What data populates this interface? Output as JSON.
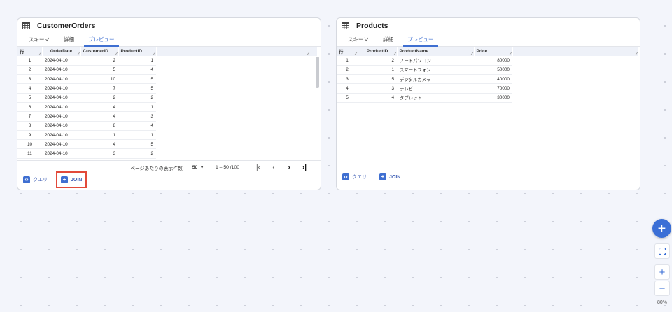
{
  "tabs": [
    "スキーマ",
    "詳細",
    "プレビュー"
  ],
  "orders": {
    "title": "CustomerOrders",
    "columns": [
      "行",
      "OrderDate",
      "CustomerID",
      "ProductID"
    ],
    "rows": [
      [
        "1",
        "2024-04-10",
        "2",
        "1"
      ],
      [
        "2",
        "2024-04-10",
        "5",
        "4"
      ],
      [
        "3",
        "2024-04-10",
        "10",
        "5"
      ],
      [
        "4",
        "2024-04-10",
        "7",
        "5"
      ],
      [
        "5",
        "2024-04-10",
        "2",
        "2"
      ],
      [
        "6",
        "2024-04-10",
        "4",
        "1"
      ],
      [
        "7",
        "2024-04-10",
        "4",
        "3"
      ],
      [
        "8",
        "2024-04-10",
        "8",
        "4"
      ],
      [
        "9",
        "2024-04-10",
        "1",
        "1"
      ],
      [
        "10",
        "2024-04-10",
        "4",
        "5"
      ],
      [
        "11",
        "2024-04-10",
        "3",
        "2"
      ]
    ],
    "pager": {
      "rows_per_page_label": "ページあたりの表示件数:",
      "rows_per_page": "50",
      "range": "1 – 50 /100"
    }
  },
  "products": {
    "title": "Products",
    "columns": [
      "行",
      "ProductID",
      "ProductName",
      "Price"
    ],
    "rows": [
      [
        "1",
        "2",
        "ノートパソコン",
        "80000"
      ],
      [
        "2",
        "1",
        "スマートフォン",
        "50000"
      ],
      [
        "3",
        "5",
        "デジタルカメラ",
        "40000"
      ],
      [
        "4",
        "3",
        "テレビ",
        "70000"
      ],
      [
        "5",
        "4",
        "タブレット",
        "30000"
      ]
    ]
  },
  "actions": {
    "query_label": "クエリ",
    "join_label": "JOIN"
  },
  "zoom": {
    "level": "80%"
  },
  "colors": {
    "accent": "#3f6fd1",
    "highlight": "#e24a3a"
  },
  "icons": {
    "table": "table-icon",
    "query": "code-icon",
    "join": "plus-box-icon",
    "add": "plus-icon",
    "fit": "fit-screen-icon",
    "zoom_in": "plus-icon",
    "zoom_out": "minus-icon"
  }
}
